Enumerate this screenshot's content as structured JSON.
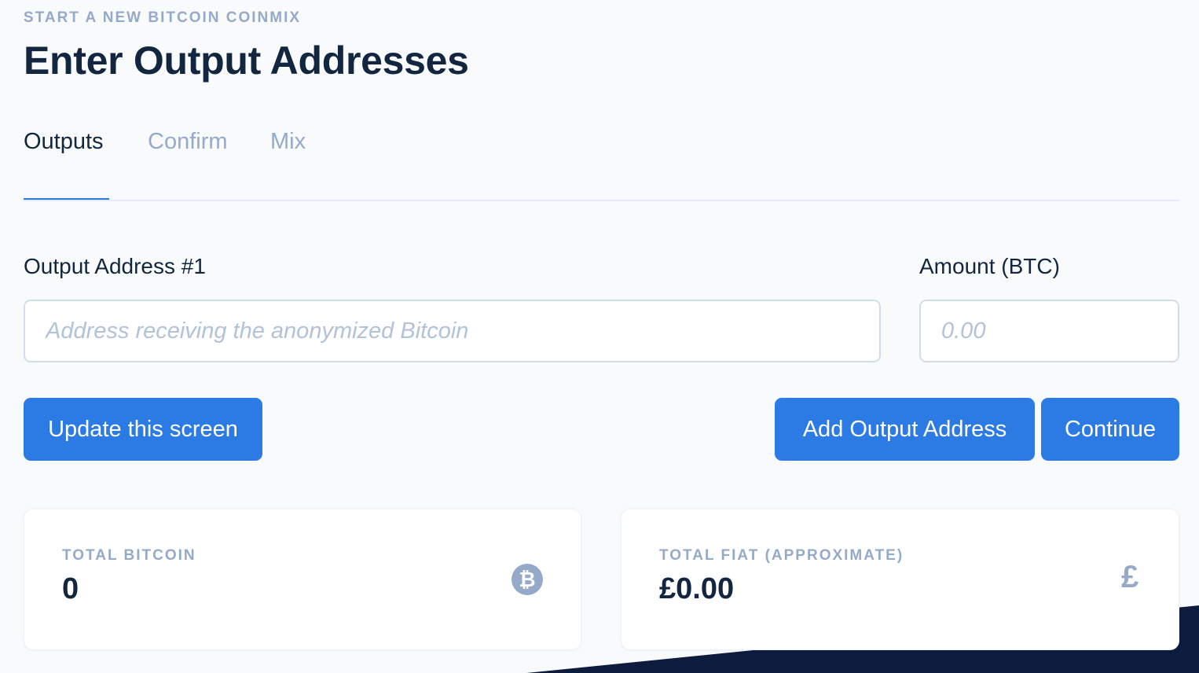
{
  "header": {
    "pretitle": "START A NEW BITCOIN COINMIX",
    "title": "Enter Output Addresses"
  },
  "tabs": [
    {
      "label": "Outputs",
      "active": true
    },
    {
      "label": "Confirm",
      "active": false
    },
    {
      "label": "Mix",
      "active": false
    }
  ],
  "form": {
    "address_label": "Output Address #1",
    "address_placeholder": "Address receiving the anonymized Bitcoin",
    "address_value": "",
    "amount_label": "Amount (BTC)",
    "amount_placeholder": "0.00",
    "amount_value": ""
  },
  "actions": {
    "update_label": "Update this screen",
    "add_label": "Add Output Address",
    "continue_label": "Continue"
  },
  "totals": {
    "bitcoin_label": "TOTAL BITCOIN",
    "bitcoin_value": "0",
    "bitcoin_icon": "bitcoin-icon",
    "bitcoin_icon_glyph": "₿",
    "fiat_label": "TOTAL FIAT (APPROXIMATE)",
    "fiat_value": "£0.00",
    "fiat_icon": "pound-icon",
    "fiat_icon_glyph": "£"
  },
  "colors": {
    "primary": "#2c7be5",
    "heading": "#12263f",
    "muted": "#95aac9",
    "background": "#f8fafc",
    "footer_dark": "#0d1b3e"
  }
}
